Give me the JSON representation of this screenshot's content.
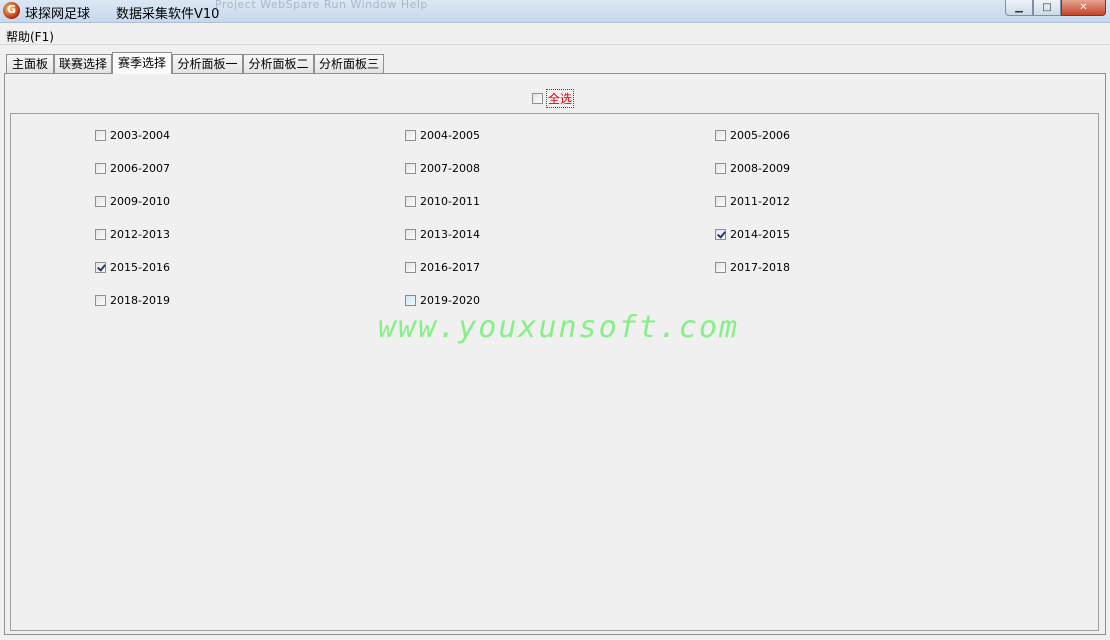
{
  "window": {
    "title": "球探网足球　　数据采集软件V10",
    "icon": "app-logo-icon",
    "ghost_menu": "Project  WebSpare  Run  Window  Help",
    "controls": {
      "minimize": "▁",
      "maximize": "□",
      "close": "✕"
    }
  },
  "menu": {
    "help": "帮助(F1)"
  },
  "tabs": [
    {
      "label": "主面板",
      "active": false
    },
    {
      "label": "联赛选择",
      "active": false
    },
    {
      "label": "赛季选择",
      "active": true
    },
    {
      "label": "分析面板一",
      "active": false
    },
    {
      "label": "分析面板二",
      "active": false
    },
    {
      "label": "分析面板三",
      "active": false
    }
  ],
  "select_all": {
    "label": "全选",
    "checked": false
  },
  "seasons": [
    {
      "label": "2003-2004",
      "checked": false
    },
    {
      "label": "2004-2005",
      "checked": false
    },
    {
      "label": "2005-2006",
      "checked": false
    },
    {
      "label": "2006-2007",
      "checked": false
    },
    {
      "label": "2007-2008",
      "checked": false
    },
    {
      "label": "2008-2009",
      "checked": false
    },
    {
      "label": "2009-2010",
      "checked": false
    },
    {
      "label": "2010-2011",
      "checked": false
    },
    {
      "label": "2011-2012",
      "checked": false
    },
    {
      "label": "2012-2013",
      "checked": false
    },
    {
      "label": "2013-2014",
      "checked": false
    },
    {
      "label": "2014-2015",
      "checked": true
    },
    {
      "label": "2015-2016",
      "checked": true
    },
    {
      "label": "2016-2017",
      "checked": false
    },
    {
      "label": "2017-2018",
      "checked": false
    },
    {
      "label": "2018-2019",
      "checked": false
    },
    {
      "label": "2019-2020",
      "checked": false,
      "hover": true
    }
  ],
  "watermark": "www.youxunsoft.com",
  "colors": {
    "watermark": "#86ef86",
    "select_all_text": "#e00000",
    "window_bg": "#f0f0f0"
  }
}
